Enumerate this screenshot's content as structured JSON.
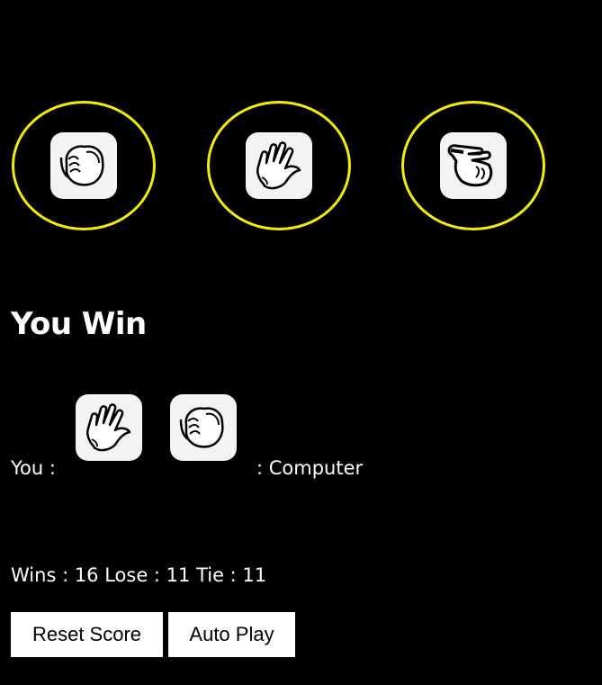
{
  "choices": [
    {
      "icon": "rock-fist-icon"
    },
    {
      "icon": "paper-hand-icon"
    },
    {
      "icon": "scissors-hand-icon"
    }
  ],
  "colors": {
    "background": "#000000",
    "text": "#ffffff",
    "choice_ring": "#f2ec0b",
    "tile": "#f3f3f3",
    "button_bg": "#ffffff",
    "button_text": "#000000"
  },
  "result": {
    "text": "You Win"
  },
  "moves": {
    "you_label": "You :",
    "you_icon": "paper-hand-icon",
    "computer_icon": "rock-fist-icon",
    "computer_label": ": Computer"
  },
  "score": {
    "text": "Wins : 16 Lose : 11 Tie : 11"
  },
  "buttons": {
    "reset_label": "Reset Score",
    "auto_label": "Auto Play"
  }
}
